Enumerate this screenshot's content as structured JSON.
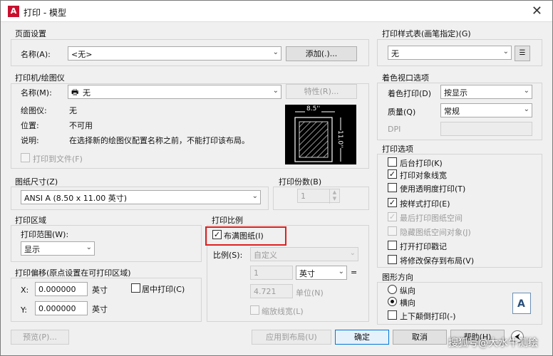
{
  "window": {
    "title": "打印 - 模型",
    "close": "✕"
  },
  "page_setup": {
    "group_label": "页面设置",
    "name_label": "名称(A):",
    "name_value": "<无>",
    "add_button": "添加(.)..."
  },
  "printer": {
    "group_label": "打印机/绘图仪",
    "name_label": "名称(M):",
    "name_value": "无",
    "properties_button": "特性(R)...",
    "plotter_label": "绘图仪:",
    "plotter_value": "无",
    "location_label": "位置:",
    "location_value": "不可用",
    "desc_label": "说明:",
    "desc_value": "在选择新的绘图仪配置名称之前，不能打印该布局。",
    "print_to_file": "打印到文件(F)",
    "preview_width": "8.5''",
    "preview_height": "11.0''"
  },
  "paper_size": {
    "group_label": "图纸尺寸(Z)",
    "value": "ANSI A (8.50 x 11.00 英寸)"
  },
  "copies": {
    "group_label": "打印份数(B)",
    "value": "1"
  },
  "plot_area": {
    "group_label": "打印区域",
    "range_label": "打印范围(W):",
    "range_value": "显示"
  },
  "plot_scale": {
    "group_label": "打印比例",
    "fit_to_paper": "布满图纸(I)",
    "scale_label": "比例(S):",
    "scale_value": "自定义",
    "value1": "1",
    "unit_value": "英寸",
    "equals": "=",
    "value2": "4.721",
    "units_label": "单位(N)",
    "scale_lineweights": "缩放线宽(L)"
  },
  "plot_offset": {
    "group_label": "打印偏移(原点设置在可打印区域)",
    "x_label": "X:",
    "x_value": "0.000000",
    "x_unit": "英寸",
    "center_plot": "居中打印(C)",
    "y_label": "Y:",
    "y_value": "0.000000",
    "y_unit": "英寸"
  },
  "plot_style_table": {
    "group_label": "打印样式表(画笔指定)(G)",
    "value": "无"
  },
  "shaded_viewport": {
    "group_label": "着色视口选项",
    "shade_label": "着色打印(D)",
    "shade_value": "按显示",
    "quality_label": "质量(Q)",
    "quality_value": "常规",
    "dpi_label": "DPI"
  },
  "plot_options": {
    "group_label": "打印选项",
    "items": [
      {
        "label": "后台打印(K)",
        "checked": ""
      },
      {
        "label": "打印对象线宽",
        "checked": "✓"
      },
      {
        "label": "使用透明度打印(T)",
        "checked": ""
      },
      {
        "label": "按样式打印(E)",
        "checked": "✓"
      },
      {
        "label": "最后打印图纸空间",
        "checked": "✓"
      },
      {
        "label": "隐藏图纸空间对象(J)",
        "checked": ""
      },
      {
        "label": "打开打印戳记",
        "checked": ""
      },
      {
        "label": "将修改保存到布局(V)",
        "checked": ""
      }
    ]
  },
  "orientation": {
    "group_label": "图形方向",
    "portrait": "纵向",
    "landscape": "横向",
    "upside_down": "上下颠倒打印(-)",
    "icon_letter": "A"
  },
  "footer": {
    "preview": "预览(P)...",
    "apply_layout": "应用到布局(U)",
    "ok": "确定",
    "cancel": "取消",
    "help": "帮助(H)",
    "more": "⮜"
  },
  "watermark": "搜狐号@大水牛测绘"
}
